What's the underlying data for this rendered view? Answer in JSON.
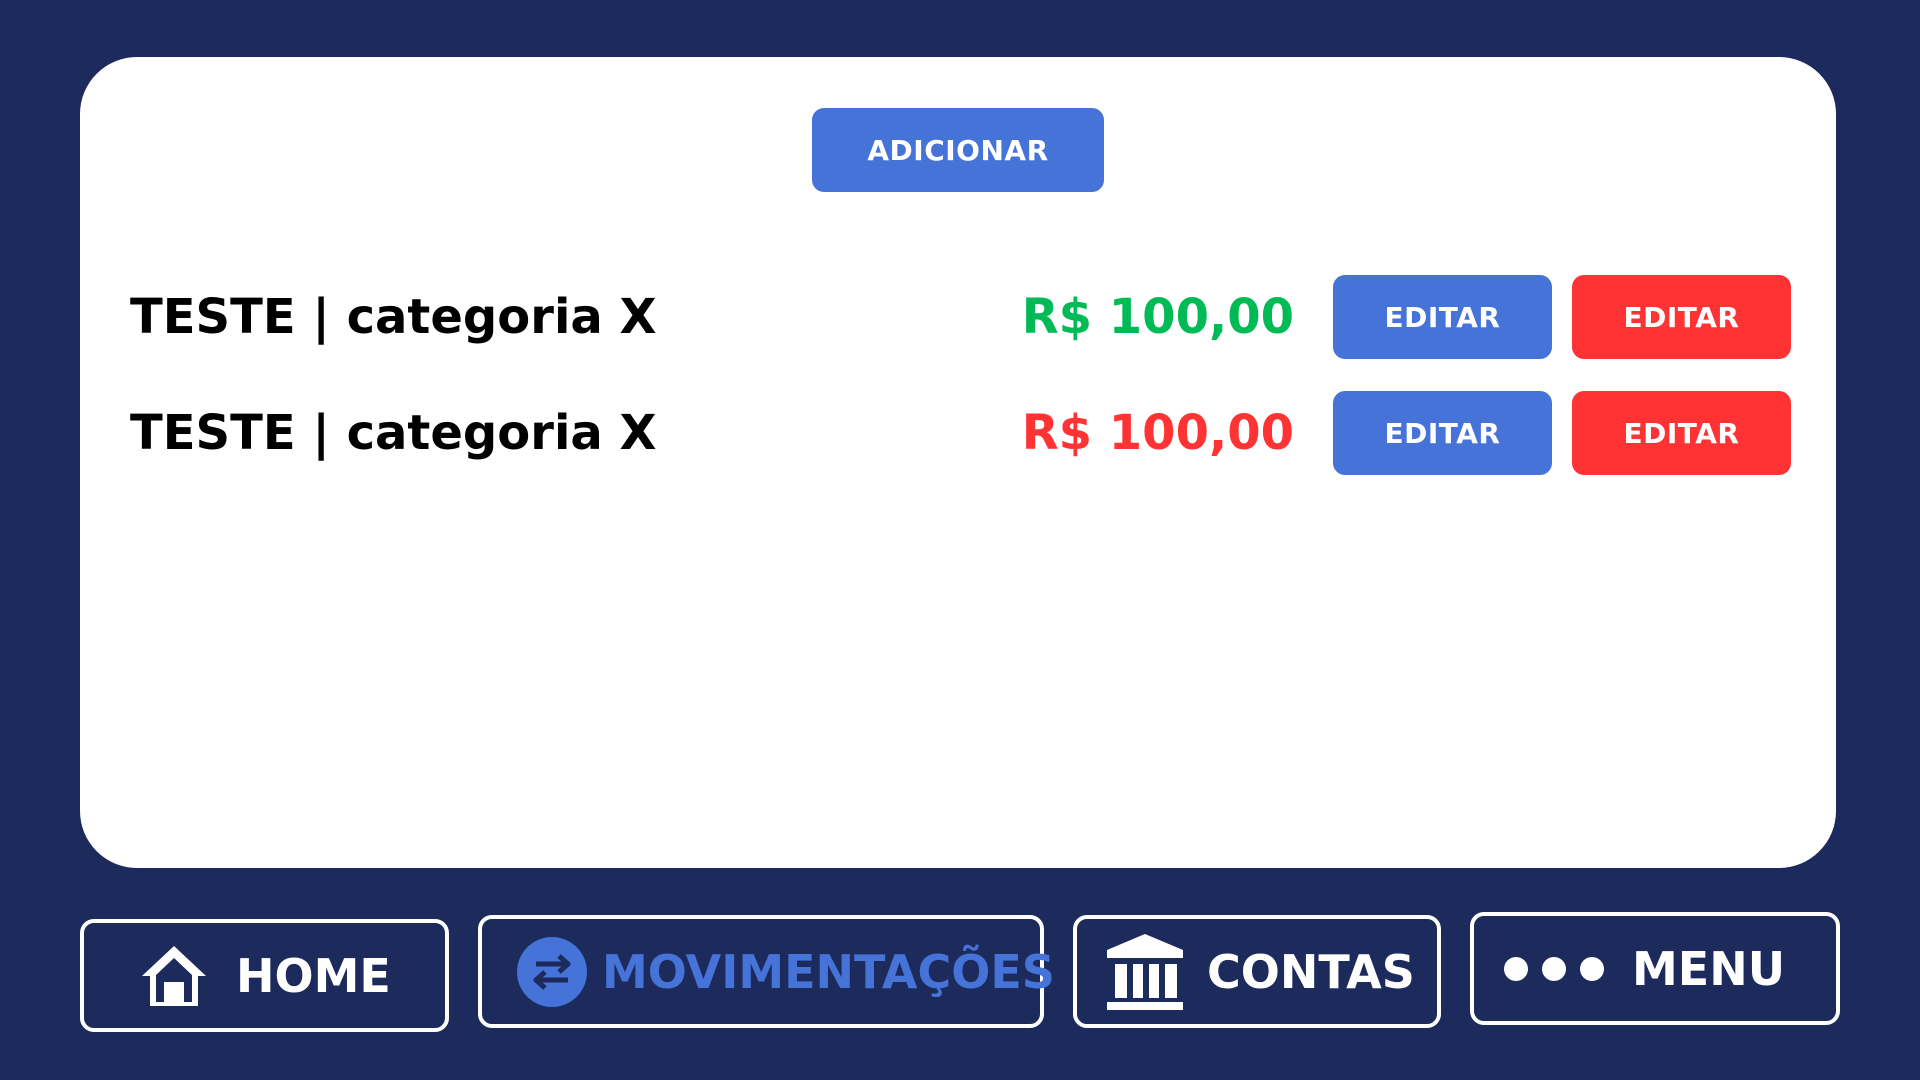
{
  "colors": {
    "background": "#1c2a5c",
    "panel": "#ffffff",
    "primary_button": "#4573d8",
    "danger_button": "#ff3333",
    "income": "#00bb55",
    "expense": "#ff3333",
    "nav_active": "#4573d8"
  },
  "toolbar": {
    "add_label": "ADICIONAR"
  },
  "transactions": [
    {
      "label": "TESTE | categoria X",
      "amount": "R$ 100,00",
      "type": "income",
      "edit_label": "EDITAR",
      "delete_label": "EDITAR"
    },
    {
      "label": "TESTE | categoria X",
      "amount": "R$ 100,00",
      "type": "expense",
      "edit_label": "EDITAR",
      "delete_label": "EDITAR"
    }
  ],
  "nav": {
    "items": [
      {
        "label": "HOME",
        "icon": "home-icon",
        "active": false
      },
      {
        "label": "MOVIMENTAÇÕES",
        "icon": "transfer-arrows-icon",
        "active": true
      },
      {
        "label": "CONTAS",
        "icon": "bank-icon",
        "active": false
      },
      {
        "label": "MENU",
        "icon": "more-dots-icon",
        "active": false
      }
    ]
  }
}
